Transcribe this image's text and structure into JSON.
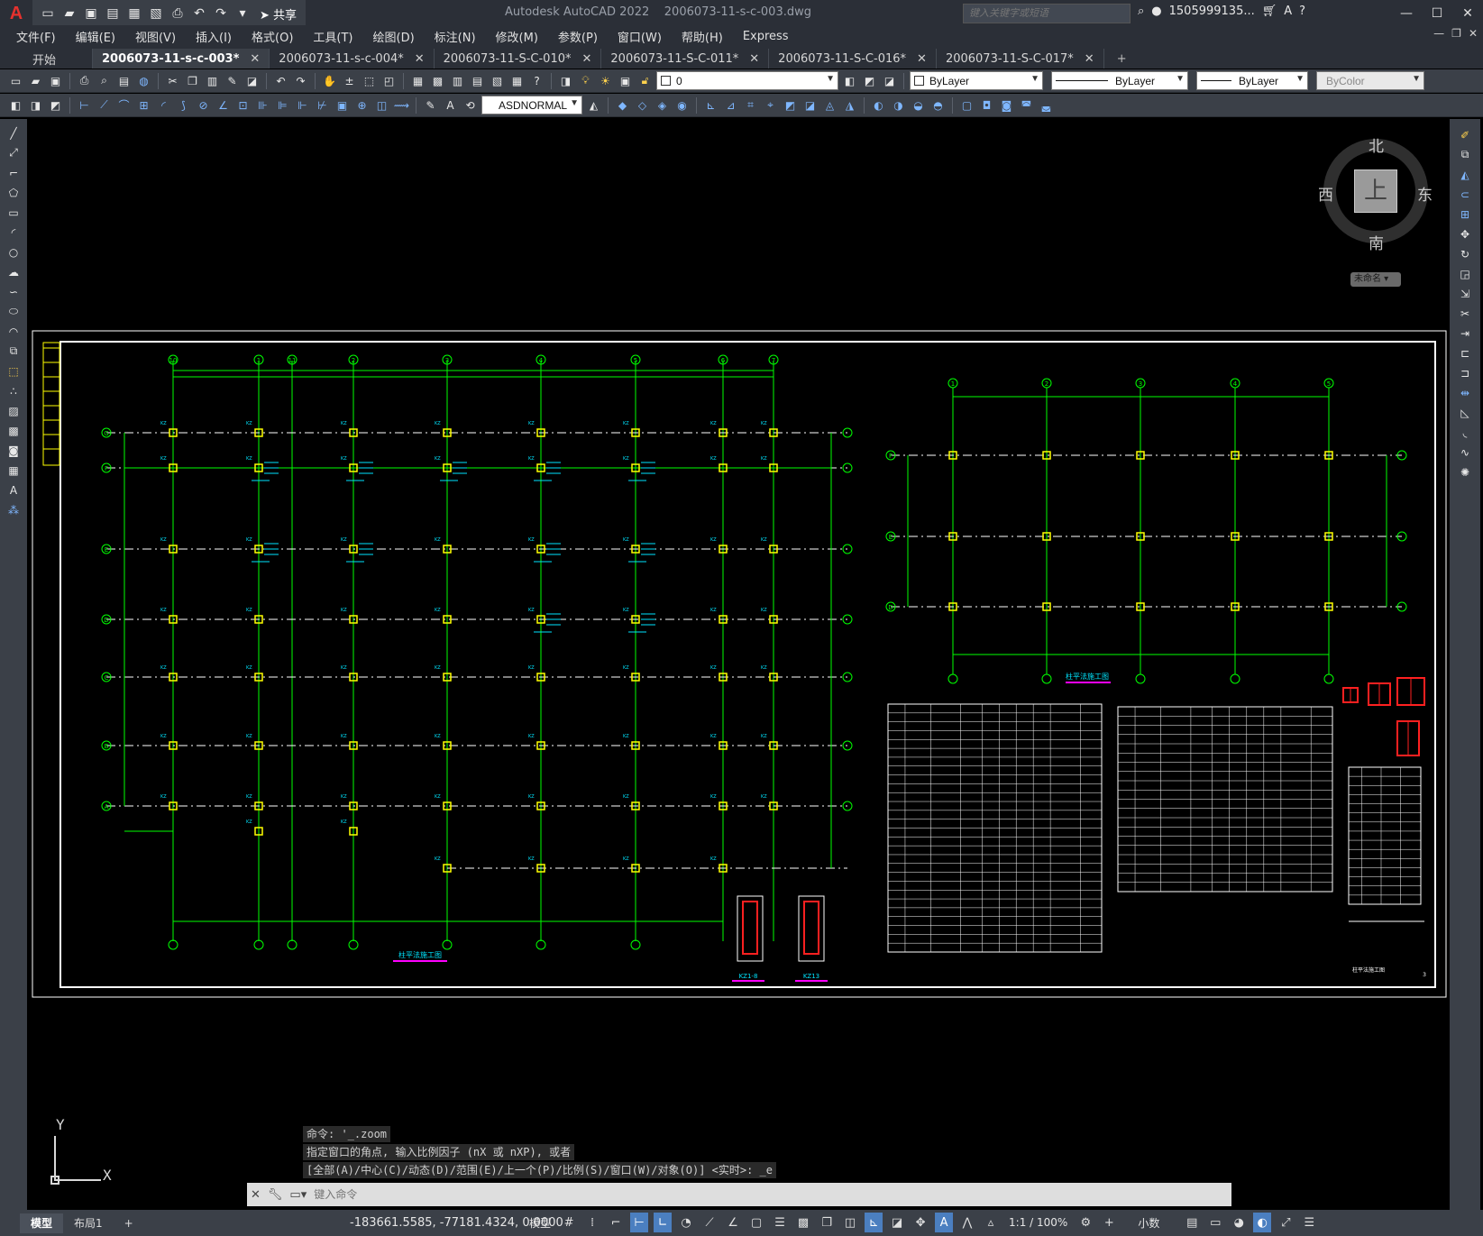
{
  "app": {
    "logo": "A",
    "title": "Autodesk AutoCAD 2022    2006073-11-s-c-003.dwg",
    "search_placeholder": "键入关键字或短语",
    "user": "1505999135...",
    "share": "共享"
  },
  "menu": [
    "文件(F)",
    "编辑(E)",
    "视图(V)",
    "插入(I)",
    "格式(O)",
    "工具(T)",
    "绘图(D)",
    "标注(N)",
    "修改(M)",
    "参数(P)",
    "窗口(W)",
    "帮助(H)",
    "Express"
  ],
  "tabs": {
    "start": "开始",
    "docs": [
      "2006073-11-s-c-003*",
      "2006073-11-s-c-004*",
      "2006073-11-S-C-010*",
      "2006073-11-S-C-011*",
      "2006073-11-S-C-016*",
      "2006073-11-S-C-017*"
    ],
    "active_index": 0,
    "plus": "+"
  },
  "layers": {
    "current_layer": "0",
    "color": "ByLayer",
    "linetype": "ByLayer",
    "lineweight": "ByLayer",
    "plotstyle": "ByColor",
    "dimstyle": "ASDNORMAL"
  },
  "viewcube": {
    "top": "上",
    "north": "北",
    "south": "南",
    "east": "东",
    "west": "西",
    "wcs": "未命名"
  },
  "ucs": {
    "x": "X",
    "y": "Y"
  },
  "drawing": {
    "colors": {
      "grid": "#00ff00",
      "column": "#ffff00",
      "axis": "#ffffff",
      "annot": "#00e5ff",
      "title": "#ff00ff",
      "rebar": "#ff2020"
    },
    "left_plan_title": "柱平法施工图",
    "right_plan_title": "柱平法施工图",
    "detail_a": "KZ1-8",
    "detail_b": "KZ13",
    "sheet_title": "柱平法施工图",
    "sheet_no": "3",
    "left_axes_top": [
      "10",
      "1",
      "11",
      "2",
      "3",
      "4",
      "5",
      "6",
      "7"
    ],
    "left_axes_side": [
      "G",
      "F",
      "E",
      "D",
      "C",
      "B",
      "A"
    ],
    "right_axes_top": [
      "1",
      "2",
      "3",
      "4",
      "5"
    ],
    "right_axes_side": [
      "F",
      "E",
      "D"
    ]
  },
  "command": {
    "history": [
      "命令: '_.zoom",
      "指定窗口的角点, 输入比例因子 (nX 或 nXP), 或者",
      "[全部(A)/中心(C)/动态(D)/范围(E)/上一个(P)/比例(S)/窗口(W)/对象(O)] <实时>: _e"
    ],
    "placeholder": "键入命令"
  },
  "status": {
    "layout_tabs": [
      "模型",
      "布局1"
    ],
    "active_layout": 0,
    "add_tab": "+",
    "coords": "-183661.5585, -77181.4324, 0.0000",
    "space": "模型",
    "scale": "1:1 / 100%",
    "units": "小数"
  }
}
